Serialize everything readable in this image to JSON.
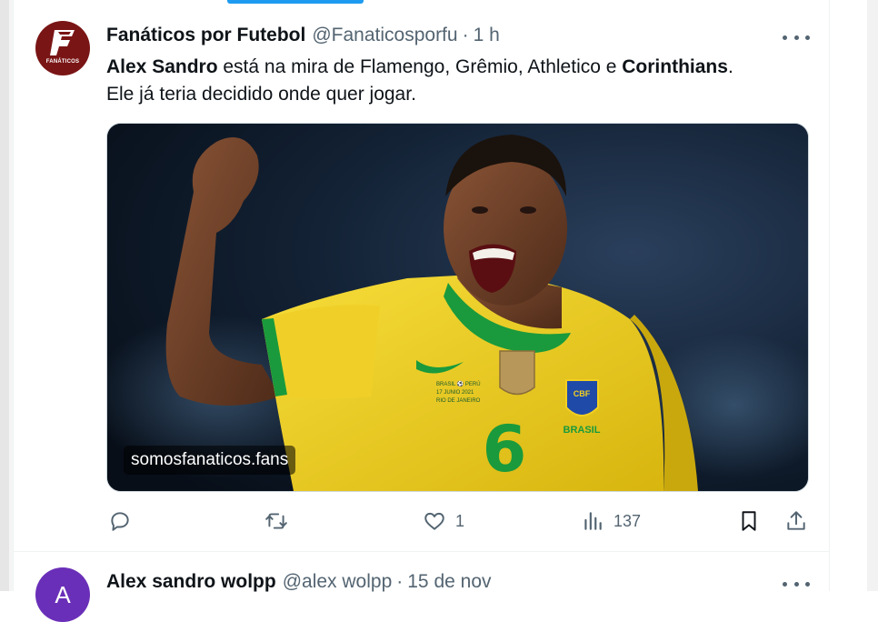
{
  "tweets": [
    {
      "author_name": "Fanáticos por Futebol",
      "handle": "@Fanaticosporfu",
      "separator": "·",
      "time": "1 h",
      "avatar_text": "FANÁTICOS",
      "avatar_letter": "F",
      "text_parts": {
        "bold1": "Alex Sandro",
        "mid": " está na mira de Flamengo, Grêmio, Athletico e ",
        "bold2": "Corinthians",
        "end": ".",
        "line2": "Ele já teria decidido onde quer jogar."
      },
      "media": {
        "label": "somosfanaticos.fans",
        "jersey_number": "6",
        "badge_text": "CBF",
        "brasil_text": "BRASIL",
        "match_text_1": "BRASIL ⚽ PERÚ",
        "match_text_2": "17 JUNIO 2021",
        "match_text_3": "RIO DE JANEIRO"
      },
      "actions": {
        "reply_count": "",
        "retweet_count": "",
        "like_count": "1",
        "views_count": "137"
      }
    },
    {
      "author_name": "Alex sandro wolpp",
      "handle": "@alex wolpp",
      "separator": "·",
      "time": "15 de nov",
      "avatar_letter": "A"
    }
  ],
  "colors": {
    "accent": "#1d9bf0",
    "text_primary": "#0f1419",
    "text_secondary": "#536471",
    "jersey_yellow": "#f3d020",
    "jersey_green": "#1a9a3c"
  },
  "icons": [
    "reply-icon",
    "retweet-icon",
    "like-icon",
    "views-icon",
    "bookmark-icon",
    "share-icon",
    "more-icon"
  ]
}
